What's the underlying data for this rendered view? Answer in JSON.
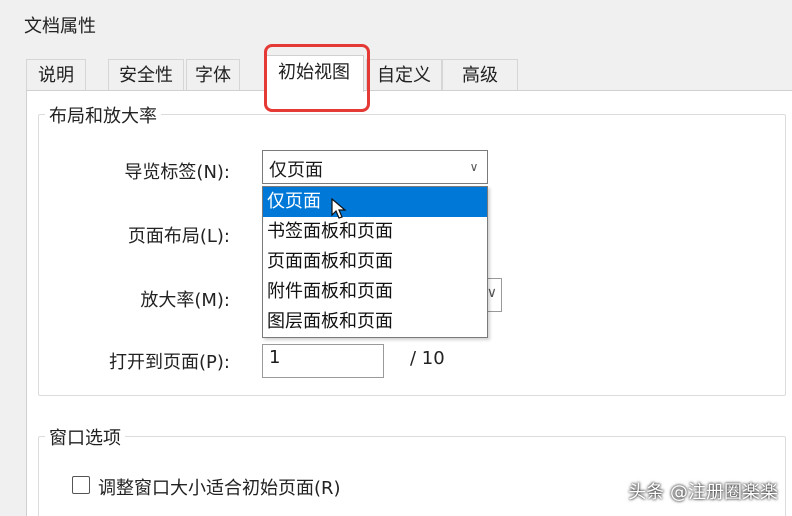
{
  "window": {
    "title": "文档属性"
  },
  "tabs": [
    {
      "label": "说明"
    },
    {
      "label": "安全性"
    },
    {
      "label": "字体"
    },
    {
      "label": "初始视图"
    },
    {
      "label": "自定义"
    },
    {
      "label": "高级"
    }
  ],
  "layout_group": {
    "legend": "布局和放大率",
    "nav_label": "导览标签(N):",
    "nav_value": "仅页面",
    "nav_options": [
      "仅页面",
      "书签面板和页面",
      "页面面板和页面",
      "附件面板和页面",
      "图层面板和页面"
    ],
    "page_layout_label": "页面布局(L):",
    "zoom_label": "放大率(M):",
    "open_to_page_label": "打开到页面(P):",
    "open_to_page_value": "1",
    "page_total": "/ 10"
  },
  "window_group": {
    "legend": "窗口选项",
    "resize_label": "调整窗口大小适合初始页面(R)",
    "resize_checked": false
  },
  "watermark": "头条 @注册圈楽楽",
  "colors": {
    "accent": "#0078d7",
    "highlight": "#e53935"
  }
}
